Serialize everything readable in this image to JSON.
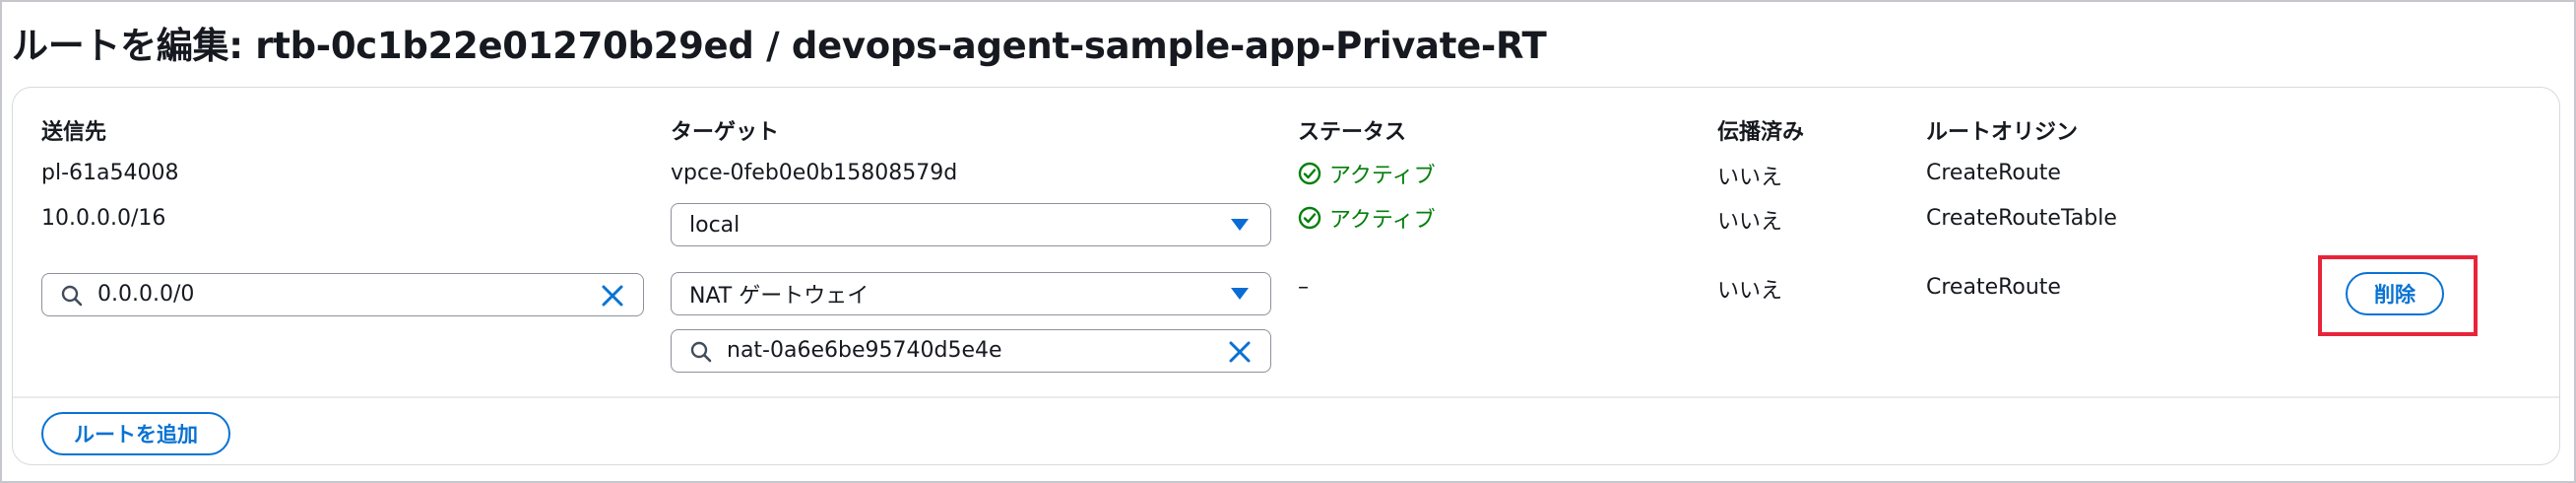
{
  "page": {
    "title": "ルートを編集: rtb-0c1b22e01270b29ed / devops-agent-sample-app-Private-RT"
  },
  "columns": {
    "destination": "送信先",
    "target": "ターゲット",
    "status": "ステータス",
    "propagated": "伝播済み",
    "origin": "ルートオリジン"
  },
  "routes": [
    {
      "destination": "pl-61a54008",
      "target": "vpce-0feb0e0b15808579d",
      "status": "アクティブ",
      "propagated": "いいえ",
      "origin": "CreateRoute"
    },
    {
      "destination": "10.0.0.0/16",
      "target_select": "local",
      "status": "アクティブ",
      "propagated": "いいえ",
      "origin": "CreateRouteTable"
    },
    {
      "destination_input": "0.0.0.0/0",
      "target_select": "NAT ゲートウェイ",
      "target_search": "nat-0a6e6be95740d5e4e",
      "status": "–",
      "propagated": "いいえ",
      "origin": "CreateRoute",
      "remove_label": "削除"
    }
  ],
  "actions": {
    "add_route_label": "ルートを追加"
  },
  "colors": {
    "accent": "#0972d3",
    "status_active": "#037f0c",
    "highlight": "#e8243a"
  },
  "icons": [
    "check-circle-icon",
    "search-icon",
    "clear-icon",
    "caret-down-icon"
  ]
}
